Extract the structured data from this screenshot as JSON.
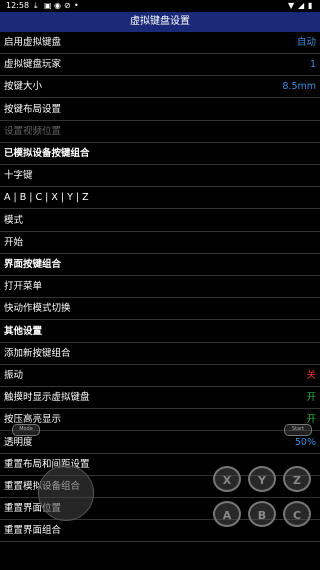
{
  "status": {
    "time": "12:58"
  },
  "app": {
    "title": "虚拟键盘设置"
  },
  "rows": [
    {
      "label": "启用虚拟键盘",
      "value": "自动",
      "color": "#3a8fe0"
    },
    {
      "label": "虚拟键盘玩家",
      "value": "1",
      "color": "#3a8fe0"
    },
    {
      "label": "按键大小",
      "value": "8.5mm",
      "color": "#3a8fe0"
    },
    {
      "label": "按键布局设置",
      "value": ""
    },
    {
      "label": "设置视频位置",
      "value": "",
      "disabled": true
    },
    {
      "label": "已模拟设备按键组合",
      "value": "",
      "section": true
    },
    {
      "label": "十字键",
      "value": ""
    },
    {
      "label": "A | B | C | X | Y | Z",
      "value": ""
    },
    {
      "label": "模式",
      "value": ""
    },
    {
      "label": "开始",
      "value": ""
    },
    {
      "label": "界面按键组合",
      "value": "",
      "section": true
    },
    {
      "label": "打开菜单",
      "value": ""
    },
    {
      "label": "快动作模式切换",
      "value": ""
    },
    {
      "label": "其他设置",
      "value": "",
      "section": true
    },
    {
      "label": "添加新按键组合",
      "value": ""
    },
    {
      "label": "振动",
      "value": "关",
      "color": "#e03838"
    },
    {
      "label": "触摸时显示虚拟键盘",
      "value": "开",
      "color": "#2fb54a"
    },
    {
      "label": "按压高亮显示",
      "value": "开",
      "color": "#2fb54a"
    },
    {
      "label": "透明度",
      "value": "50%",
      "color": "#3a8fe0"
    },
    {
      "label": "重置布局和间距设置",
      "value": ""
    },
    {
      "label": "重置模拟设备组合",
      "value": ""
    },
    {
      "label": "重置界面位置",
      "value": ""
    },
    {
      "label": "重置界面组合",
      "value": ""
    }
  ],
  "overlay": {
    "mode_pill": "Mode",
    "start_pill": "Start",
    "buttons": [
      "X",
      "Y",
      "Z",
      "A",
      "B",
      "C"
    ]
  }
}
